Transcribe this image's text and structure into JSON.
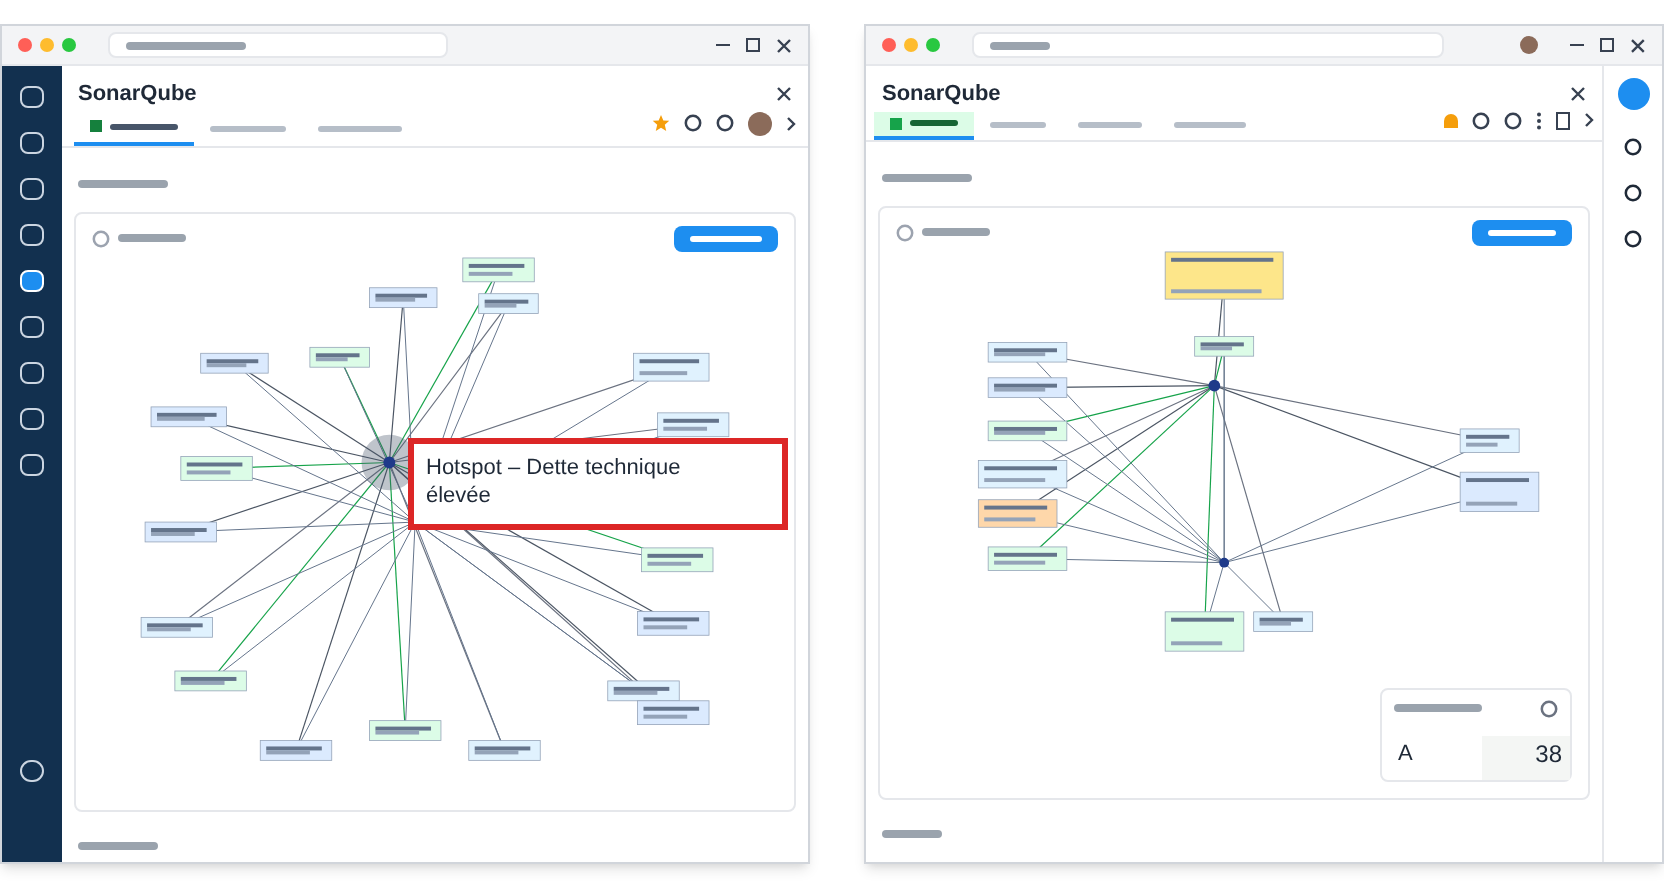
{
  "left": {
    "app_title": "SonarQube",
    "tabs": [
      {
        "selected": true
      },
      {
        "selected": false
      },
      {
        "selected": false
      }
    ],
    "callout": "Hotspot – Dette technique élevée"
  },
  "right": {
    "app_title": "SonarQube",
    "tabs": [
      {
        "selected": true
      },
      {
        "selected": false
      },
      {
        "selected": false
      },
      {
        "selected": false
      }
    ],
    "metric": {
      "grade": "A",
      "value": "38"
    }
  }
}
